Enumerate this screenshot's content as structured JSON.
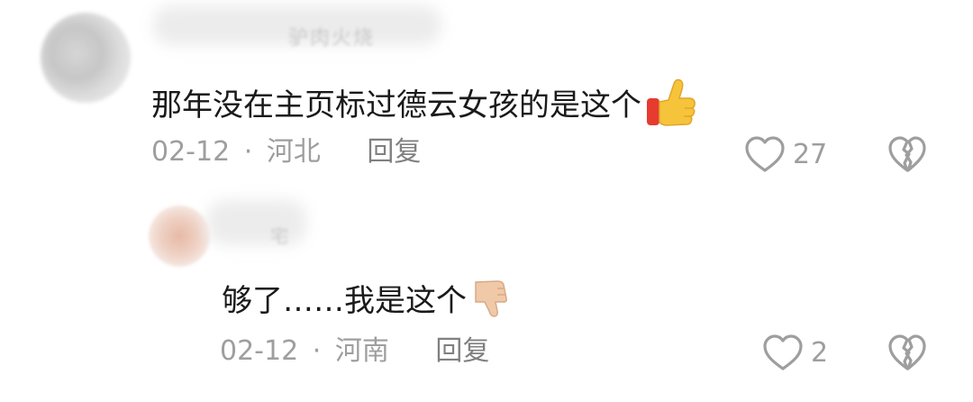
{
  "comments": [
    {
      "username": "驴肉火烧",
      "text": "那年没在主页标过德云女孩的是这个",
      "emoji": "thumbs-up",
      "date": "02-12",
      "separator": "·",
      "location": "河北",
      "reply_label": "回复",
      "like_count": "27"
    },
    {
      "username": "宅",
      "text": "够了……我是这个",
      "emoji": "thumbs-down",
      "date": "02-12",
      "separator": "·",
      "location": "河南",
      "reply_label": "回复",
      "like_count": "2"
    }
  ],
  "colors": {
    "text_primary": "#1a1a1a",
    "text_secondary": "#9e9e9e",
    "thumb_yellow": "#f6c43a",
    "cuff_red": "#e63b2e",
    "skin_tone": "#f0c9a8"
  }
}
